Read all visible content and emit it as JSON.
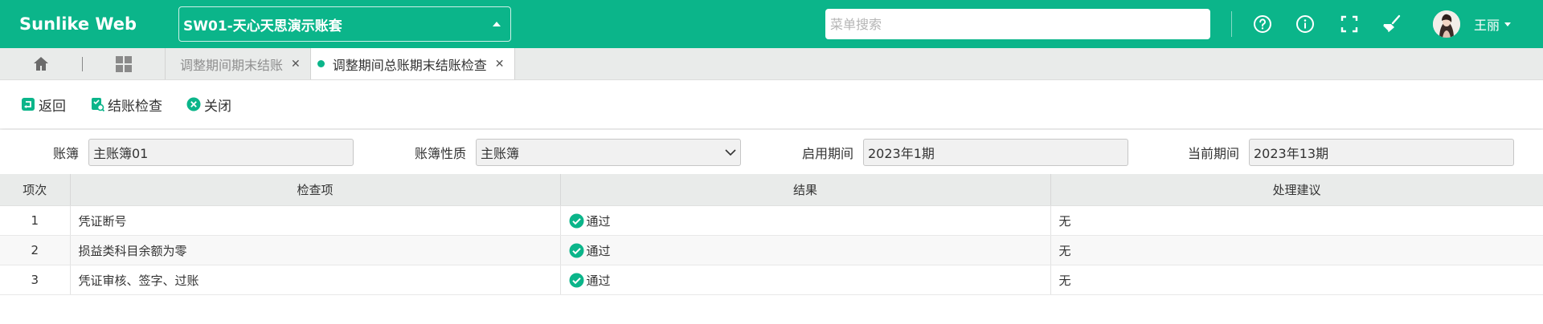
{
  "header": {
    "brand": "Sunlike Web",
    "account_set": "SW01-天心天思演示账套",
    "search_placeholder": "菜单搜索",
    "user_name": "王丽",
    "accent_color": "#0bb58a",
    "icons": [
      "help-icon",
      "info-icon",
      "fullscreen-icon",
      "clean-icon"
    ]
  },
  "tabs": [
    {
      "label": "调整期间期末结账",
      "active": false
    },
    {
      "label": "调整期间总账期末结账检查",
      "active": true
    }
  ],
  "toolbar": {
    "back_label": "返回",
    "check_label": "结账检查",
    "close_label": "关闭"
  },
  "filters": {
    "ledger_label": "账簿",
    "ledger_value": "主账簿01",
    "nature_label": "账簿性质",
    "nature_value": "主账簿",
    "start_label": "启用期间",
    "start_value": "2023年1期",
    "current_label": "当前期间",
    "current_value": "2023年13期"
  },
  "table": {
    "columns": [
      "项次",
      "检查项",
      "结果",
      "处理建议"
    ],
    "rows": [
      {
        "no": "1",
        "item": "凭证断号",
        "result": "通过",
        "advice": "无"
      },
      {
        "no": "2",
        "item": "损益类科目余额为零",
        "result": "通过",
        "advice": "无"
      },
      {
        "no": "3",
        "item": "凭证审核、签字、过账",
        "result": "通过",
        "advice": "无"
      }
    ]
  }
}
